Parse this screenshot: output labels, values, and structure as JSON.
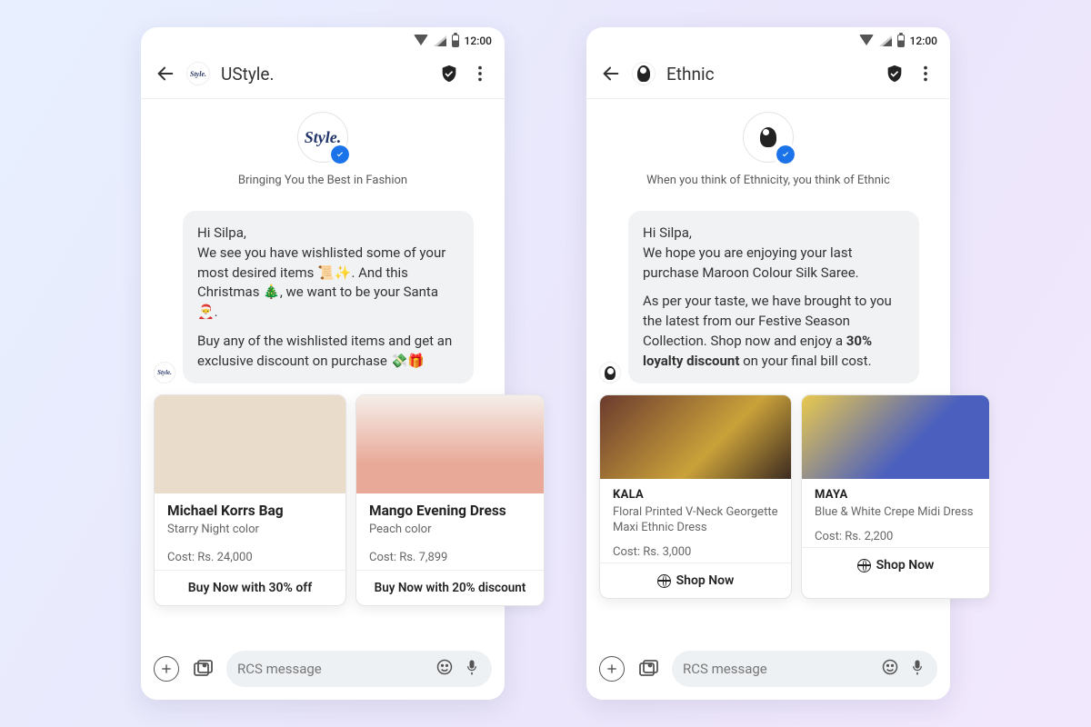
{
  "status": {
    "time": "12:00"
  },
  "input": {
    "placeholder": "RCS message"
  },
  "phones": [
    {
      "title": "UStyle.",
      "logo_text": "Style.",
      "tagline": "Bringing You the Best in Fashion",
      "message": {
        "greeting": "Hi Silpa,",
        "p1": "We see you have wishlisted some of your most desired items 📜✨. And this Christmas 🎄, we want to be your Santa 🎅.",
        "p2": "Buy any of the wishlisted items and get an exclusive discount on purchase 💸🎁"
      },
      "cards": [
        {
          "title": "Michael Korrs Bag",
          "sub": "Starry Night color",
          "cost": "Cost: Rs. 24,000",
          "action": "Buy Now with 30% off"
        },
        {
          "title": "Mango Evening Dress",
          "sub": "Peach color",
          "cost": "Cost: Rs. 7,899",
          "action": "Buy Now with 20% discount"
        }
      ]
    },
    {
      "title": "Ethnic",
      "tagline": "When you think of Ethnicity, you think of Ethnic",
      "message": {
        "greeting": "Hi Silpa,",
        "p1": "We hope you are enjoying your last purchase Maroon Colour Silk Saree.",
        "p2_a": "As per your taste, we have brought to you the latest from our Festive Season Collection. Shop now and enjoy a ",
        "p2_bold": "30% loyalty discount",
        "p2_b": " on your final bill cost."
      },
      "cards": [
        {
          "title": "KALA",
          "sub": "Floral Printed V-Neck Georgette Maxi Ethnic Dress",
          "cost": "Cost: Rs. 3,000",
          "action": "Shop Now"
        },
        {
          "title": "MAYA",
          "sub": "Blue & White Crepe Midi Dress",
          "cost": "Cost: Rs. 2,200",
          "action": "Shop Now"
        }
      ]
    }
  ]
}
